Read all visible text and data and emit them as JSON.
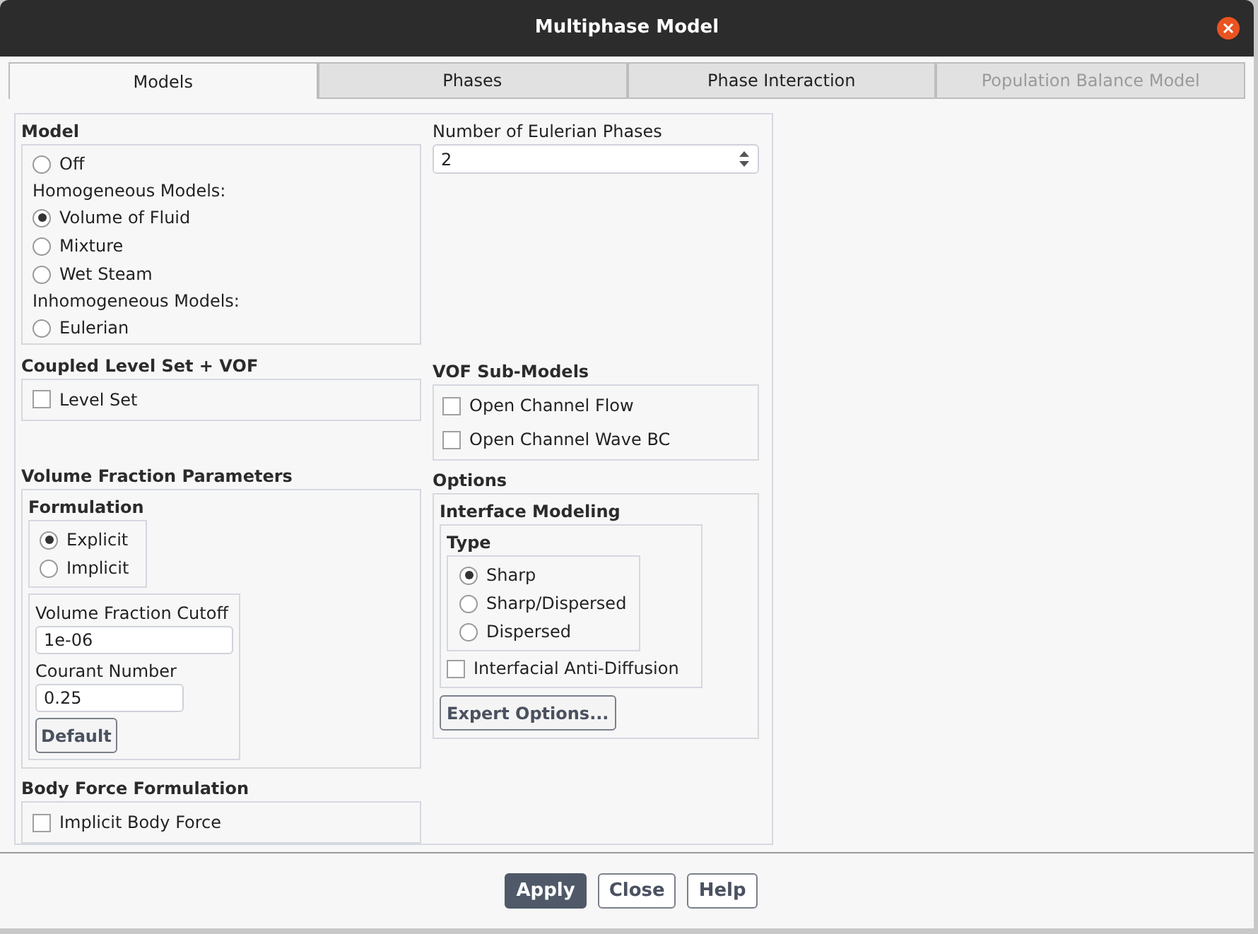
{
  "window": {
    "title": "Multiphase Model"
  },
  "tabs": [
    {
      "label": "Models",
      "selected": true,
      "disabled": false
    },
    {
      "label": "Phases",
      "selected": false,
      "disabled": false
    },
    {
      "label": "Phase Interaction",
      "selected": false,
      "disabled": false
    },
    {
      "label": "Population Balance Model",
      "selected": false,
      "disabled": true
    }
  ],
  "model": {
    "title": "Model",
    "items": [
      {
        "kind": "radio",
        "label": "Off",
        "selected": false
      },
      {
        "kind": "heading",
        "label": "Homogeneous Models:"
      },
      {
        "kind": "radio",
        "label": "Volume of Fluid",
        "selected": true
      },
      {
        "kind": "radio",
        "label": "Mixture",
        "selected": false
      },
      {
        "kind": "radio",
        "label": "Wet Steam",
        "selected": false
      },
      {
        "kind": "heading",
        "label": "Inhomogeneous Models:"
      },
      {
        "kind": "radio",
        "label": "Eulerian",
        "selected": false
      }
    ]
  },
  "eulerian_phases": {
    "label": "Number of Eulerian Phases",
    "value": "2"
  },
  "coupled_level_set": {
    "title": "Coupled Level Set + VOF",
    "options": [
      {
        "label": "Level Set",
        "checked": false
      }
    ]
  },
  "vof_sub_models": {
    "title": "VOF Sub-Models",
    "options": [
      {
        "label": "Open Channel Flow",
        "checked": false
      },
      {
        "label": "Open Channel Wave BC",
        "checked": false
      }
    ]
  },
  "volume_fraction_parameters": {
    "title": "Volume Fraction Parameters",
    "formulation": {
      "title": "Formulation",
      "options": [
        {
          "label": "Explicit",
          "selected": true
        },
        {
          "label": "Implicit",
          "selected": false
        }
      ]
    },
    "fields": [
      {
        "label": "Volume Fraction Cutoff",
        "value": "1e-06"
      },
      {
        "label": "Courant Number",
        "value": "0.25"
      }
    ],
    "default_button": "Default"
  },
  "options": {
    "title": "Options",
    "interface_modeling": {
      "title": "Interface Modeling",
      "type": {
        "title": "Type",
        "options": [
          {
            "label": "Sharp",
            "selected": true
          },
          {
            "label": "Sharp/Dispersed",
            "selected": false
          },
          {
            "label": "Dispersed",
            "selected": false
          }
        ]
      },
      "anti_diffusion": {
        "label": "Interfacial Anti-Diffusion",
        "checked": false
      }
    },
    "expert_button": "Expert Options..."
  },
  "body_force": {
    "title": "Body Force Formulation",
    "options": [
      {
        "label": "Implicit Body Force",
        "checked": false
      }
    ]
  },
  "buttons": [
    {
      "label": "Apply",
      "kind": "primary"
    },
    {
      "label": "Close",
      "kind": "default"
    },
    {
      "label": "Help",
      "kind": "default"
    }
  ]
}
